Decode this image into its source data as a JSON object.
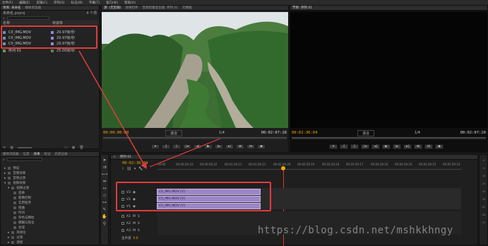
{
  "menu": [
    "文件(F)",
    "编辑(E)",
    "剪辑(C)",
    "序列(S)",
    "标记(M)",
    "字幕(T)",
    "窗口(W)",
    "帮助(H)"
  ],
  "project": {
    "tabs": [
      "项目: 未命名",
      "媒体浏览器"
    ],
    "title": "未命名.prproj",
    "count": "4 个项",
    "search_placeholder": "",
    "header_name": "名称",
    "header_rate": "帧速率",
    "files": [
      {
        "name": "C0_IMG.MOV",
        "rate": "29.97帧/秒"
      },
      {
        "name": "C0_IMG.MOV",
        "rate": "29.97帧/秒"
      },
      {
        "name": "C0_IMG.MOV",
        "rate": "29.97帧/秒"
      }
    ],
    "sequence": {
      "name": "序列 01",
      "rate": "25.00帧/秒"
    }
  },
  "source_monitor": {
    "tabs": [
      "源: (无剪辑)",
      "效果控件",
      "音频剪辑混合器: 序列 01",
      "元数据"
    ],
    "timecode_in": "00:00:00:00",
    "fit": "适合",
    "timecode_out": "00:02:07:28",
    "page": "1/4"
  },
  "program_monitor": {
    "tabs": [
      "节目: 序列 01"
    ],
    "timecode_in": "00:02:36:04",
    "fit": "适合",
    "timecode_out": "00:02:07:20",
    "page": "1/4"
  },
  "effects": {
    "tabs": [
      "媒体浏览器",
      "信息",
      "效果",
      "标记",
      "历史记录"
    ],
    "folders": [
      "预设",
      "音频效果",
      "音频过渡",
      "视频效果",
      "视频过渡"
    ],
    "items": [
      "变换",
      "图像控制",
      "实用程序",
      "扭曲",
      "时间",
      "杂色与颗粒",
      "模糊与锐化",
      "生成",
      "视频",
      "调整"
    ],
    "more_folders": [
      "风格化",
      "过渡",
      "透视"
    ]
  },
  "timeline": {
    "tabs": [
      "序列 01"
    ],
    "timecode": "00:02:36:04",
    "ruler": [
      "00:00",
      "00:00:29:23",
      "00:00:59:22",
      "00:01:29:21",
      "00:01:59:21",
      "00:02:29:20",
      "00:02:59:19",
      "00:03:29:18",
      "00:03:59:17",
      "00:04:29:16",
      "00:04:59:16",
      "00:05:29:15",
      "00:05:59:14"
    ],
    "video_tracks": [
      "V3",
      "V2",
      "V1"
    ],
    "audio_tracks": [
      "A1",
      "A2",
      "A3"
    ],
    "master_label": "主声道",
    "master_value": "0.0",
    "clips": [
      "C0_IMG.MOV [V]",
      "C0_IMG.MOV [V]",
      "C0_IMG.MOV [V]"
    ]
  },
  "watermark": "https://blog.csdn.net/mshkkhngy",
  "colors": {
    "annotation_red": "#e23b3b",
    "clip_purple": "#9c86c6",
    "timecode_orange": "#f0a500"
  }
}
